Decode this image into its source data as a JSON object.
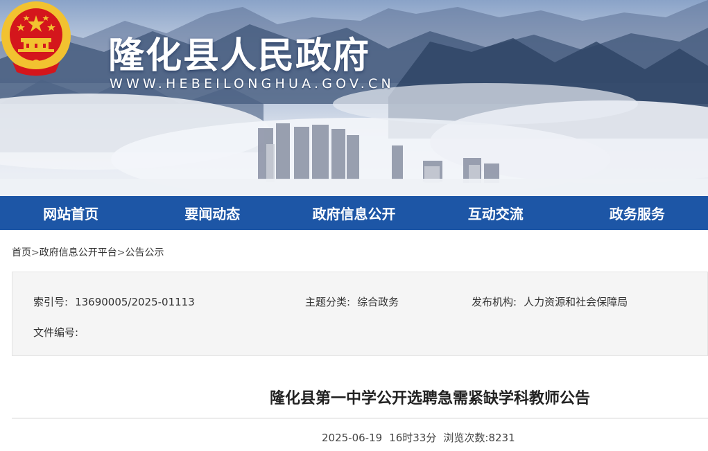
{
  "header": {
    "site_title": "隆化县人民政府",
    "site_url": "WWW.HEBEILONGHUA.GOV.CN"
  },
  "nav": {
    "items": [
      "网站首页",
      "要闻动态",
      "政府信息公开",
      "互动交流",
      "政务服务"
    ]
  },
  "breadcrumb": {
    "home": "首页",
    "sep": ">",
    "platform": "政府信息公开平台",
    "current": "公告公示"
  },
  "meta": {
    "index_label": "索引号:",
    "index_value": "13690005/2025-01113",
    "topic_label": "主题分类:",
    "topic_value": "综合政务",
    "org_label": "发布机构:",
    "org_value": "人力资源和社会保障局",
    "docno_label": "文件编号:",
    "docno_value": ""
  },
  "article": {
    "title": "隆化县第一中学公开选聘急需紧缺学科教师公告",
    "date": "2025-06-19",
    "time": "16时33分",
    "views_label": "浏览次数:",
    "views": "8231"
  },
  "colors": {
    "nav_bg": "#1d56a6",
    "emblem_red": "#d4161c",
    "emblem_gold": "#f2c230"
  }
}
